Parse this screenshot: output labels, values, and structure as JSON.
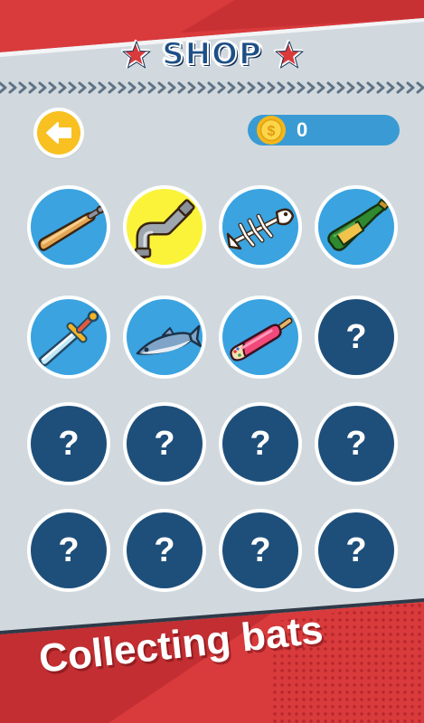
{
  "header": {
    "title": "SHOP",
    "star_color": "#d93a3c",
    "title_color": "#1d4f86"
  },
  "toolbar": {
    "back_icon": "arrow-left-icon",
    "coin_icon": "dollar-coin-icon",
    "coins": "0"
  },
  "grid": {
    "rows": [
      [
        {
          "item": "baseball-bat",
          "state": "unlocked"
        },
        {
          "item": "pipe",
          "state": "selected"
        },
        {
          "item": "fish-bone",
          "state": "unlocked"
        },
        {
          "item": "bottle",
          "state": "unlocked"
        }
      ],
      [
        {
          "item": "sword",
          "state": "unlocked"
        },
        {
          "item": "fish",
          "state": "unlocked"
        },
        {
          "item": "popsicle",
          "state": "unlocked"
        },
        {
          "item": "locked",
          "state": "locked",
          "label": "?"
        }
      ],
      [
        {
          "item": "locked",
          "state": "locked",
          "label": "?"
        },
        {
          "item": "locked",
          "state": "locked",
          "label": "?"
        },
        {
          "item": "locked",
          "state": "locked",
          "label": "?"
        },
        {
          "item": "locked",
          "state": "locked",
          "label": "?"
        }
      ],
      [
        {
          "item": "locked",
          "state": "locked",
          "label": "?"
        },
        {
          "item": "locked",
          "state": "locked",
          "label": "?"
        },
        {
          "item": "locked",
          "state": "locked",
          "label": "?"
        },
        {
          "item": "locked",
          "state": "locked",
          "label": "?"
        }
      ]
    ]
  },
  "colors": {
    "unlocked_bg": "#3aa3e0",
    "selected_bg": "#faf33a",
    "locked_bg": "#1e4f7a",
    "coin_bar": "#3a9bd4",
    "accent_red": "#d93a3c"
  },
  "promo": {
    "caption": "Collecting bats"
  }
}
